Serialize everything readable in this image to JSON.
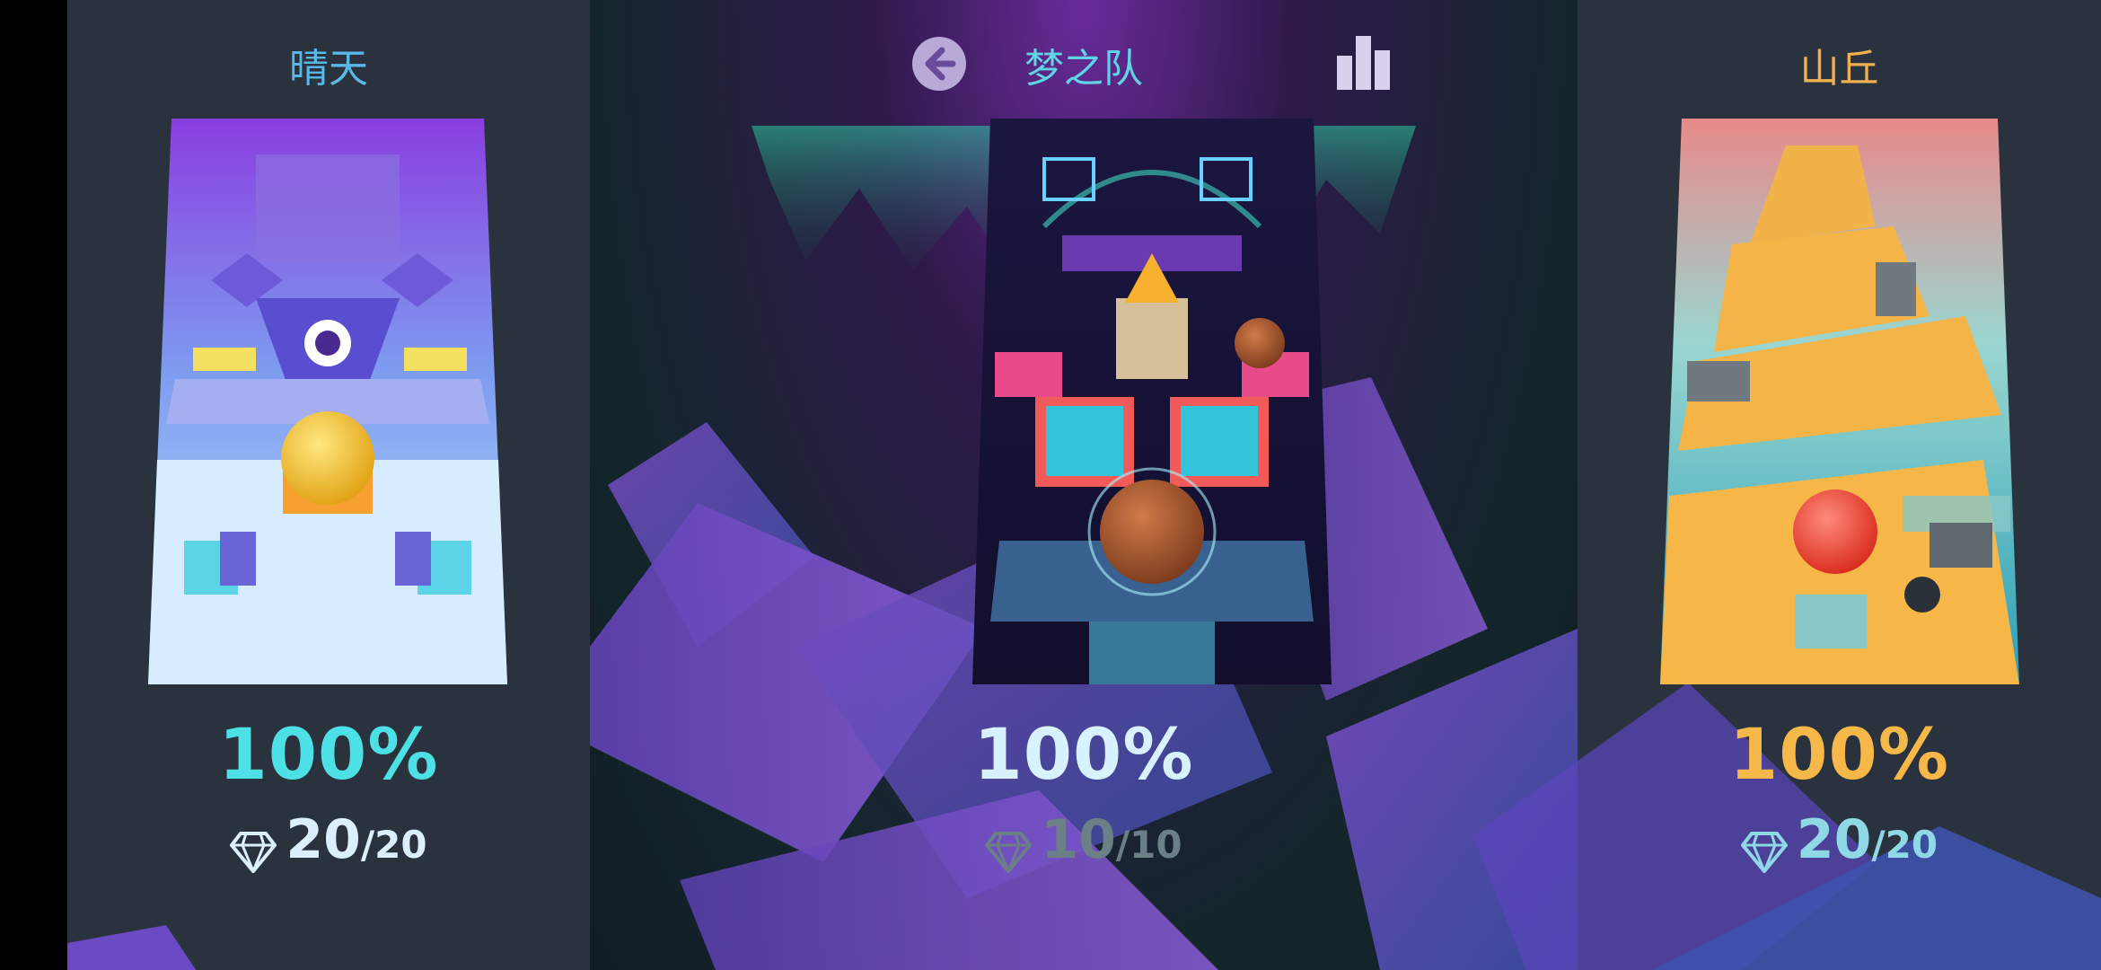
{
  "levels": [
    {
      "title": "晴天",
      "percent": "100%",
      "gems_collected": "20",
      "gems_total": "/20",
      "title_color": "#5ab8e8",
      "percent_color": "#4de0e6",
      "gems_color": "#dcefff"
    },
    {
      "title": "梦之队",
      "percent": "100%",
      "gems_collected": "10",
      "gems_total": "/10",
      "title_color": "#5fd4e6",
      "percent_color": "#d8f2ff",
      "gems_color": "#6b7f87"
    },
    {
      "title": "山丘",
      "percent": "100%",
      "gems_collected": "20",
      "gems_total": "/20",
      "title_color": "#f0b050",
      "percent_color": "#f7b84a",
      "gems_color": "#8fd8e6"
    }
  ],
  "top_bar": {
    "back_icon": "arrow-left-icon",
    "leaderboard_icon": "bar-chart-icon"
  },
  "gem_icon": "diamond-icon"
}
